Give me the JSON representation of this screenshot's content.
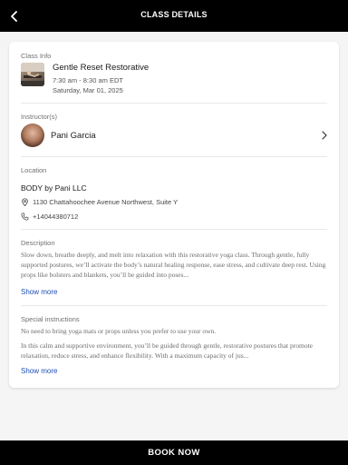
{
  "header": {
    "title": "CLASS DETAILS"
  },
  "class_info": {
    "label": "Class Info",
    "name": "Gentle Reset Restorative",
    "time": "7:30 am - 8:30 am EDT",
    "date": "Saturday, Mar 01, 2025"
  },
  "instructors": {
    "label": "Instructor(s)",
    "name": "Pani Garcia"
  },
  "location": {
    "label": "Location",
    "studio": "BODY by Pani LLC",
    "address": "1130 Chattahoochee Avenue Northwest, Suite Y",
    "phone": "+14044380712"
  },
  "description": {
    "label": "Description",
    "text": "Slow down, breathe deeply, and melt into relaxation with this restorative yoga class. Through gentle, fully supported postures, we’ll activate the body’s natural healing response, ease stress, and cultivate deep rest. Using props like bolsters and blankets, you’ll be guided into poses...",
    "show_more": "Show more"
  },
  "special_instructions": {
    "label": "Special instructions",
    "line1": "No need to bring yoga mats or props unless you prefer to use your own.",
    "line2": "In this calm and supportive environment, you’ll be guided through gentle, restorative postures that promote relaxation, reduce stress, and enhance flexibility. With a maximum capacity of jus...",
    "show_more": "Show more"
  },
  "footer": {
    "cta": "BOOK NOW"
  }
}
